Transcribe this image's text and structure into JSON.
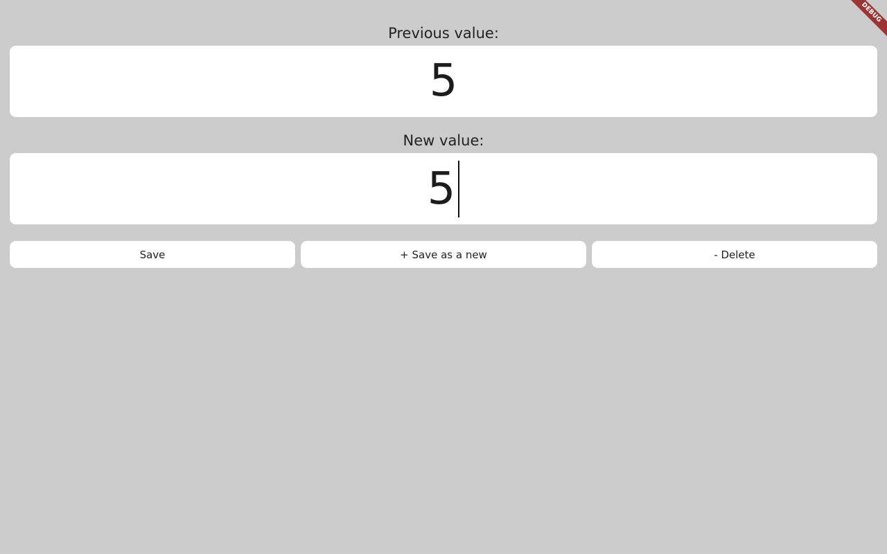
{
  "previous": {
    "label": "Previous value:",
    "value": "5"
  },
  "new": {
    "label": "New value:",
    "value": "5"
  },
  "buttons": {
    "save": "Save",
    "save_as_new": "+ Save as a new",
    "delete": "- Delete"
  },
  "debug_banner": {
    "text": "DEBUG",
    "color": "#9b3434"
  },
  "colors": {
    "background": "#cccccc",
    "card": "#ffffff",
    "text": "#1f1f1f"
  }
}
